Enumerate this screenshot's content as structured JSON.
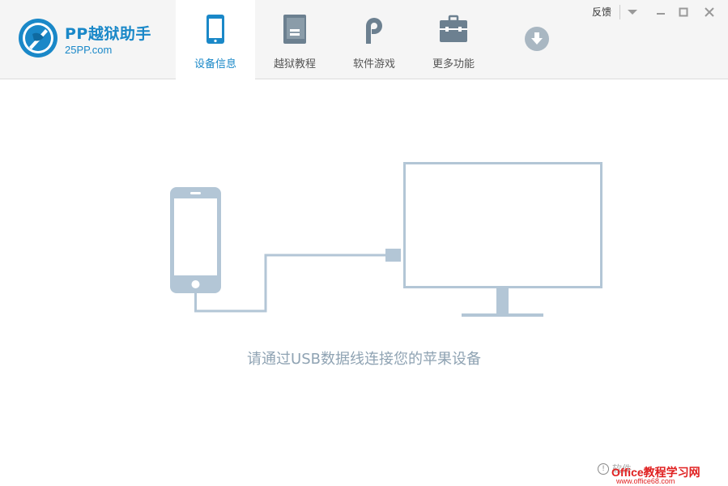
{
  "app": {
    "title": "PP越狱助手",
    "site": "25PP.com"
  },
  "nav": {
    "items": [
      {
        "label": "设备信息",
        "active": true
      },
      {
        "label": "越狱教程",
        "active": false
      },
      {
        "label": "软件游戏",
        "active": false
      },
      {
        "label": "更多功能",
        "active": false
      }
    ]
  },
  "window": {
    "feedback": "反馈"
  },
  "main": {
    "prompt": "请通过USB数据线连接您的苹果设备",
    "info_text": "软件..."
  },
  "watermark": {
    "text": "Office教程学习网",
    "url": "www.office68.com"
  },
  "colors": {
    "brand": "#1a88c8",
    "illustration": "#b3c6d6",
    "nav_icon": "#6c8090"
  }
}
